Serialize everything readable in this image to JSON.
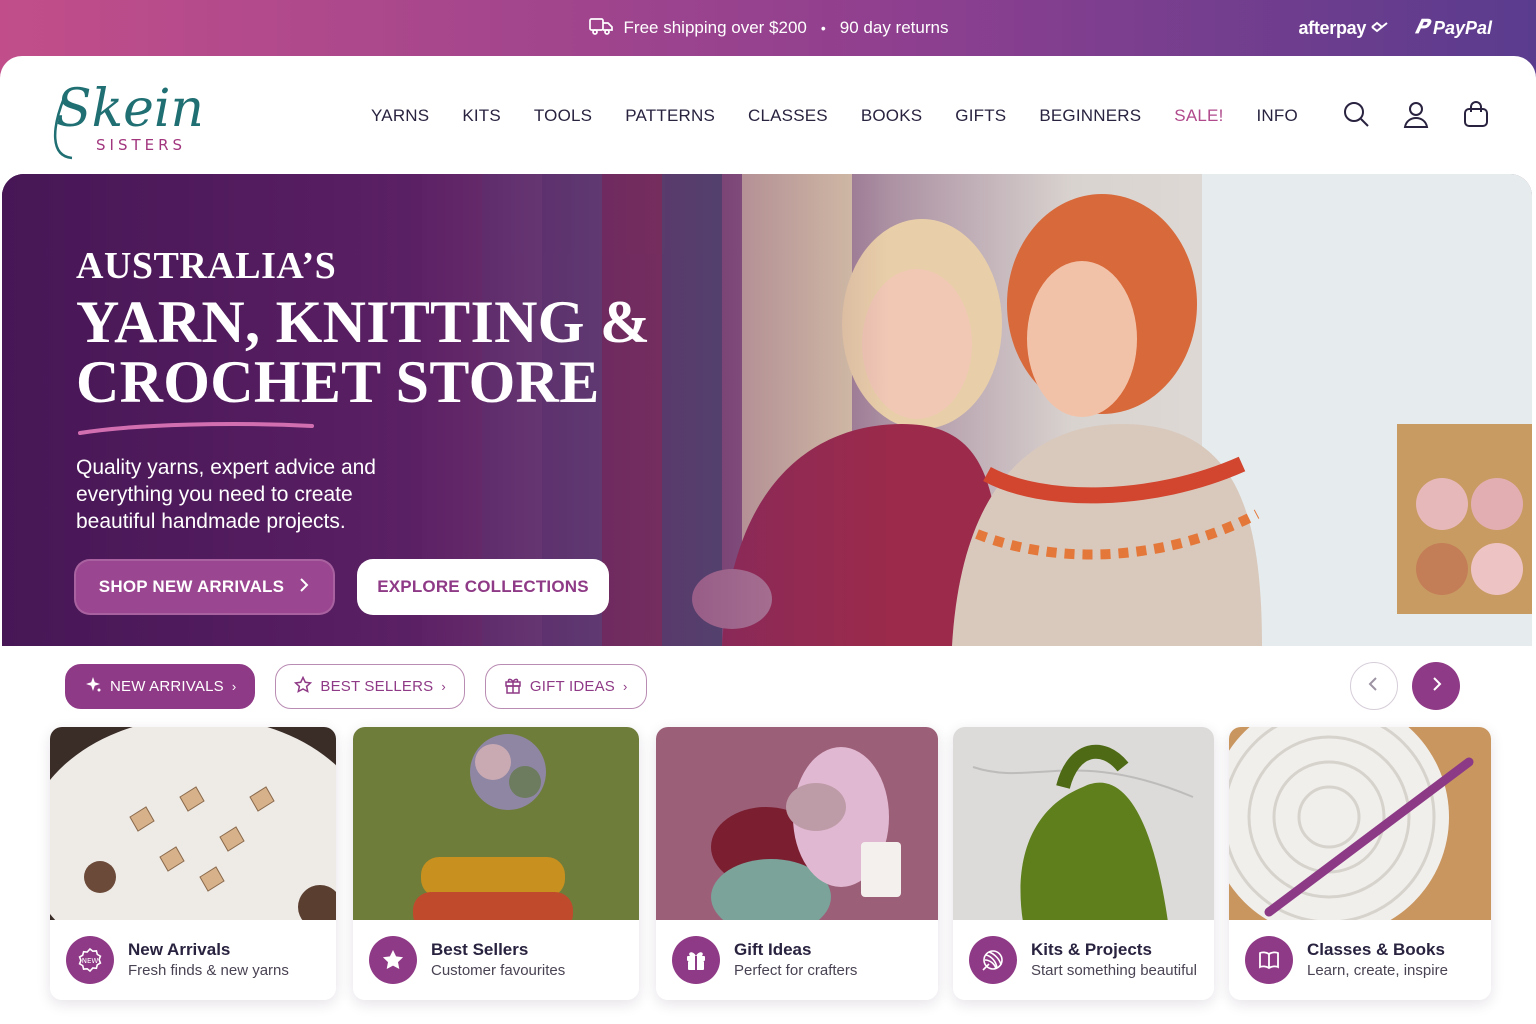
{
  "promo": {
    "shipping_text": "Free shipping over $200",
    "separator": "•",
    "returns_text": "90 day returns",
    "afterpay_label": "afterpay",
    "paypal_label": "PayPal"
  },
  "brand": {
    "logo_script": "Skein",
    "logo_caps": "SISTERS"
  },
  "nav": [
    {
      "label": "YARNS"
    },
    {
      "label": "KITS"
    },
    {
      "label": "TOOLS"
    },
    {
      "label": "PATTERNS"
    },
    {
      "label": "CLASSES"
    },
    {
      "label": "BOOKS"
    },
    {
      "label": "GIFTS"
    },
    {
      "label": "BEGINNERS"
    },
    {
      "label": "SALE!"
    },
    {
      "label": "INFO"
    }
  ],
  "header_icons": [
    "search-icon",
    "account-icon",
    "cart-icon"
  ],
  "hero": {
    "kicker": "AUSTRALIA’S",
    "title_line1": "YARN, KNITTING &",
    "title_line2": "CROCHET STORE",
    "subtitle": "Quality yarns, expert advice and everything you need to create beautiful handmade projects.",
    "primary_cta": "SHOP NEW ARRIVALS",
    "secondary_cta": "EXPLORE COLLECTIONS"
  },
  "chips": [
    {
      "label": "NEW ARRIVALS",
      "icon": "sparkle-icon",
      "active": true
    },
    {
      "label": "BEST SELLERS",
      "icon": "star-outline-icon",
      "active": false
    },
    {
      "label": "GIFT IDEAS",
      "icon": "gift-outline-icon",
      "active": false
    }
  ],
  "cards": [
    {
      "title": "New Arrivals",
      "subtitle": "Fresh finds & new yarns",
      "icon": "new-badge-icon"
    },
    {
      "title": "Best Sellers",
      "subtitle": "Customer favourites",
      "icon": "star-icon"
    },
    {
      "title": "Gift Ideas",
      "subtitle": "Perfect for crafters",
      "icon": "gift-icon"
    },
    {
      "title": "Kits & Projects",
      "subtitle": "Start something beautiful",
      "icon": "yarn-ball-icon"
    },
    {
      "title": "Classes & Books",
      "subtitle": "Learn, create, inspire",
      "icon": "book-icon"
    }
  ],
  "colors": {
    "brand_purple": "#8f3a86",
    "promo_gradient_start": "#c14e8a",
    "promo_gradient_end": "#5a3c8e",
    "sale_pink": "#b04a8c",
    "logo_teal": "#1f6f73"
  }
}
